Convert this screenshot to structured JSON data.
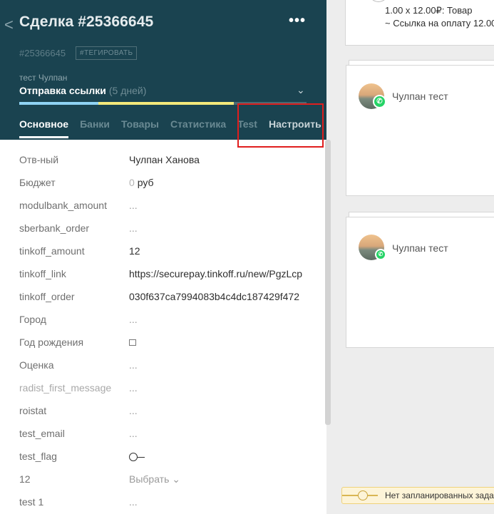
{
  "header": {
    "back": "<",
    "title": "Сделка #25366645",
    "more": "•••",
    "deal_id": "#25366645",
    "tag_button": "#ТЕГИРОВАТЬ",
    "contact": "тест Чулпан",
    "stage": "Отправка ссылки",
    "stage_days": "(5 дней)",
    "chevron": "⌄"
  },
  "tabs": [
    {
      "label": "Основное"
    },
    {
      "label": "Банки"
    },
    {
      "label": "Товары"
    },
    {
      "label": "Статистика"
    },
    {
      "label": "Test"
    },
    {
      "label": "Настроить"
    }
  ],
  "fields": [
    {
      "label": "Отв-ный",
      "value": "Чулпан Ханова"
    },
    {
      "label": "Бюджет",
      "zero": "0",
      "value": "руб"
    },
    {
      "label": "modulbank_amount",
      "value": "..."
    },
    {
      "label": "sberbank_order",
      "value": "..."
    },
    {
      "label": "tinkoff_amount",
      "value": "12"
    },
    {
      "label": "tinkoff_link",
      "value": "https://securepay.tinkoff.ru/new/PgzLcp"
    },
    {
      "label": "tinkoff_order",
      "value": "030f637ca7994083b4c4dc187429f472"
    },
    {
      "label": "Город",
      "value": "..."
    },
    {
      "label": "Год рождения",
      "value": ""
    },
    {
      "label": "Оценка",
      "value": "..."
    },
    {
      "label": "radist_first_message",
      "value": "..."
    },
    {
      "label": "roistat",
      "value": "..."
    },
    {
      "label": "test_email",
      "value": "..."
    },
    {
      "label": "test_flag",
      "value": ""
    },
    {
      "label": "12",
      "value": "Выбрать ⌄"
    },
    {
      "label": "test 1",
      "value": "..."
    }
  ],
  "feed": {
    "product_line1": "1.00 x 12.00₽: Товар",
    "product_line2": "~ Ссылка на оплату 12.00",
    "messages": [
      {
        "name": "Чулпан тест"
      },
      {
        "name": "Чулпан тест"
      }
    ],
    "notice": "Нет запланированных задач"
  },
  "colors": {
    "header_bg": "#1a4350",
    "highlight": "#e01e1e",
    "whatsapp": "#25d366"
  }
}
